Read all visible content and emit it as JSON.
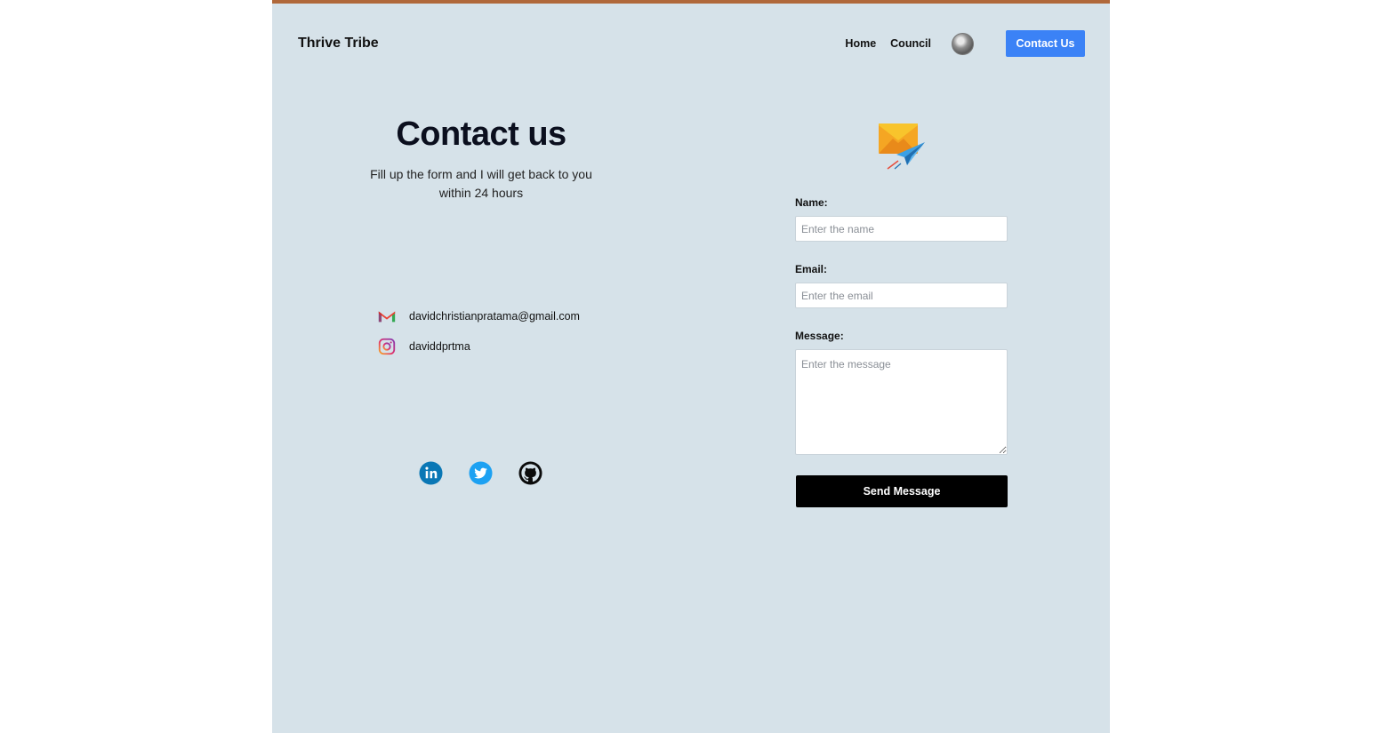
{
  "brand": "Thrive Tribe",
  "nav": {
    "home": "Home",
    "council": "Council",
    "cta": "Contact Us"
  },
  "contact": {
    "title": "Contact us",
    "subtitle": "Fill up the form and I will get back to you within 24 hours",
    "email": "davidchristianpratama@gmail.com",
    "instagram": "daviddprtma"
  },
  "form": {
    "name_label": "Name:",
    "name_placeholder": "Enter the name",
    "email_label": "Email:",
    "email_placeholder": "Enter the email",
    "message_label": "Message:",
    "message_placeholder": "Enter the message",
    "submit": "Send Message"
  },
  "colors": {
    "page_bg": "#d6e2e9",
    "accent": "#3b82f6",
    "top_border": "#b0683a",
    "submit_bg": "#000000"
  },
  "icons": {
    "email": "gmail-icon",
    "instagram": "instagram-icon",
    "socials": [
      "linkedin-icon",
      "twitter-icon",
      "github-icon"
    ],
    "hero": "envelope-paper-plane-icon"
  }
}
